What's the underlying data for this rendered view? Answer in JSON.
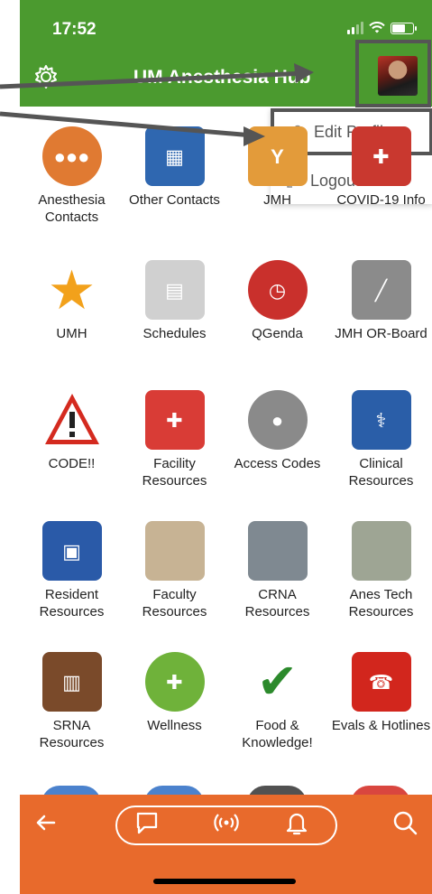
{
  "status": {
    "time": "17:52"
  },
  "header": {
    "title": "UM Anesthesia Hub"
  },
  "menu": {
    "edit_profile": "Edit Profile",
    "logout": "Logout"
  },
  "tiles": [
    {
      "label": "Anesthesia Contacts",
      "icon": "people-icon",
      "color": "#e07a32"
    },
    {
      "label": "Other Contacts",
      "icon": "folder-people-icon",
      "color": "#2f67b0"
    },
    {
      "label": "JMH",
      "icon": "jmh-logo-icon",
      "color": "#e39b3a"
    },
    {
      "label": "COVID-19 Info",
      "icon": "covid-icon",
      "color": "#c9382f"
    },
    {
      "label": "UMH",
      "icon": "vip-star-icon",
      "color": "#f2a11b"
    },
    {
      "label": "Schedules",
      "icon": "calendar-clock-icon",
      "color": "#d0d0d0"
    },
    {
      "label": "QGenda",
      "icon": "clock-icon",
      "color": "#c9302c"
    },
    {
      "label": "JMH OR-Board",
      "icon": "scalpel-icon",
      "color": "#8b8b8b"
    },
    {
      "label": "CODE!!",
      "icon": "warning-icon",
      "color": "#d42a1f"
    },
    {
      "label": "Facility Resources",
      "icon": "hospital-icon",
      "color": "#d93c36"
    },
    {
      "label": "Access Codes",
      "icon": "padlock-icon",
      "color": "#8a8a8a"
    },
    {
      "label": "Clinical Resources",
      "icon": "caduceus-icon",
      "color": "#2a5ea8"
    },
    {
      "label": "Resident Resources",
      "icon": "address-book-icon",
      "color": "#2a5aa8"
    },
    {
      "label": "Faculty Resources",
      "icon": "folder-tan-icon",
      "color": "#c7b394"
    },
    {
      "label": "CRNA Resources",
      "icon": "folder-gray-icon",
      "color": "#7f8991"
    },
    {
      "label": "Anes Tech Resources",
      "icon": "folder-olive-icon",
      "color": "#9ea594"
    },
    {
      "label": "SRNA Resources",
      "icon": "books-icon",
      "color": "#7a4a2a"
    },
    {
      "label": "Wellness",
      "icon": "plus-circle-icon",
      "color": "#6fb23a"
    },
    {
      "label": "Food & Knowledge!",
      "icon": "checkmark-icon",
      "color": "#2c8a2c"
    },
    {
      "label": "Evals & Hotlines",
      "icon": "telephone-icon",
      "color": "#d2261d"
    }
  ],
  "bottom_bar": {
    "back": "back-arrow-icon",
    "chat": "chat-bubble-icon",
    "broadcast": "broadcast-icon",
    "bell": "bell-icon",
    "search": "search-icon"
  },
  "colors": {
    "header": "#4b9a2f",
    "bottom": "#e86a2c"
  }
}
